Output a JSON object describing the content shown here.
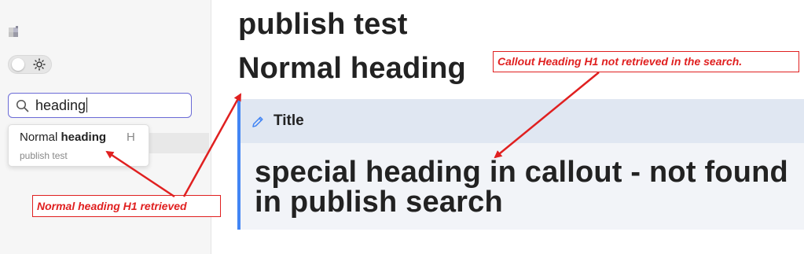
{
  "sidebar": {
    "search": {
      "value": "heading"
    },
    "result": {
      "title_prefix": "Normal ",
      "title_match": "heading",
      "badge": "H",
      "path": "publish test"
    }
  },
  "main": {
    "page_title": "publish test",
    "heading": "Normal heading",
    "callout": {
      "title": "Title",
      "body": "special heading in callout - not found in publish search"
    }
  },
  "annotations": {
    "left_note": "Normal heading H1 retrieved",
    "right_note": "Callout Heading H1 not retrieved in the search."
  },
  "colors": {
    "accent": "#4285f4",
    "annotation": "#e02020",
    "callout_header": "#e0e7f2",
    "search_border": "#6b6bd6"
  },
  "icons": {
    "logo": "site-logo-icon",
    "theme": "sun-icon",
    "search": "search-icon",
    "callout": "pencil-icon"
  }
}
